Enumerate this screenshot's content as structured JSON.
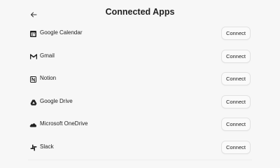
{
  "header": {
    "title": "Connected Apps"
  },
  "apps": [
    {
      "name": "Google Calendar",
      "icon": "calendar-icon",
      "action": "Connect"
    },
    {
      "name": "Gmail",
      "icon": "gmail-icon",
      "action": "Connect"
    },
    {
      "name": "Notion",
      "icon": "notion-icon",
      "action": "Connect"
    },
    {
      "name": "Google Drive",
      "icon": "google-drive-icon",
      "action": "Connect"
    },
    {
      "name": "Microsoft OneDrive",
      "icon": "onedrive-icon",
      "action": "Connect"
    },
    {
      "name": "Slack",
      "icon": "slack-icon",
      "action": "Connect"
    }
  ],
  "colors": {
    "background": "#f7f7f7",
    "text": "#1a1a1a",
    "button_border": "#e2e2e2"
  }
}
